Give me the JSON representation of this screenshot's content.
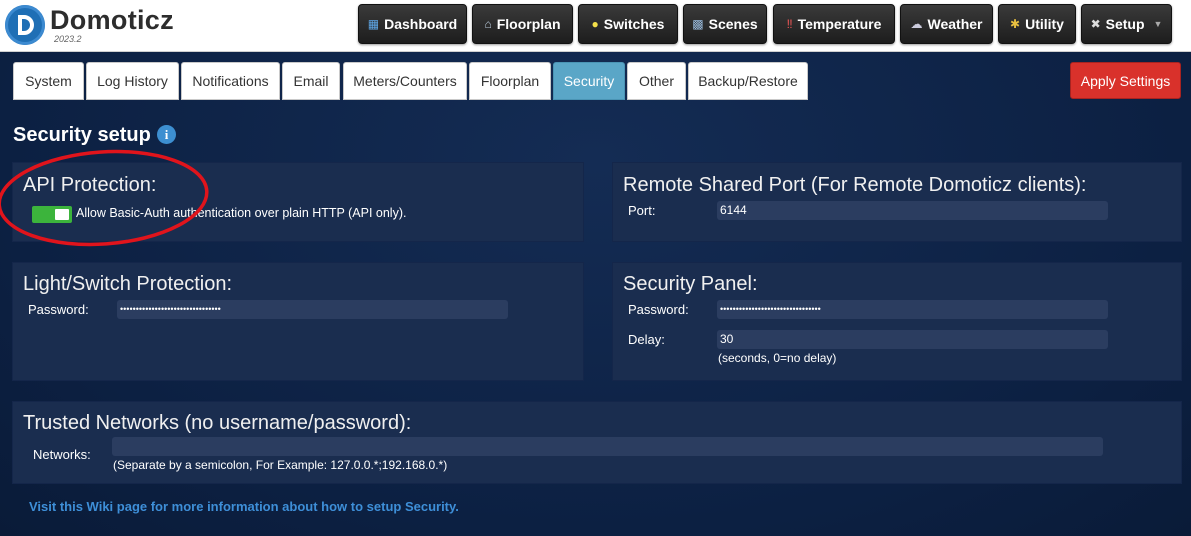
{
  "brand": {
    "name": "Domoticz",
    "version": "2023.2"
  },
  "nav": [
    {
      "label": "Dashboard",
      "icon": "dashboard-icon"
    },
    {
      "label": "Floorplan",
      "icon": "house-icon"
    },
    {
      "label": "Switches",
      "icon": "lightbulb-icon"
    },
    {
      "label": "Scenes",
      "icon": "clapper-icon"
    },
    {
      "label": "Temperature",
      "icon": "thermometer-icon"
    },
    {
      "label": "Weather",
      "icon": "cloud-icon"
    },
    {
      "label": "Utility",
      "icon": "utility-icon"
    },
    {
      "label": "Setup",
      "icon": "tools-icon"
    }
  ],
  "tabs": [
    "System",
    "Log History",
    "Notifications",
    "Email",
    "Meters/Counters",
    "Floorplan",
    "Security",
    "Other",
    "Backup/Restore"
  ],
  "active_tab": "Security",
  "apply_label": "Apply Settings",
  "page_title": "Security setup",
  "api_protection": {
    "title": "API Protection:",
    "toggle_on": true,
    "toggle_label": "Allow Basic-Auth authentication over plain HTTP (API only)."
  },
  "remote_port": {
    "title": "Remote Shared Port (For Remote Domoticz clients):",
    "port_label": "Port:",
    "port_value": "6144"
  },
  "light_switch": {
    "title": "Light/Switch Protection:",
    "password_label": "Password:",
    "password_value": "••••••••••••••••••••••••••••••••"
  },
  "security_panel": {
    "title": "Security Panel:",
    "password_label": "Password:",
    "password_value": "••••••••••••••••••••••••••••••••",
    "delay_label": "Delay:",
    "delay_value": "30",
    "delay_hint": "(seconds, 0=no delay)"
  },
  "trusted": {
    "title": "Trusted Networks (no username/password):",
    "networks_label": "Networks:",
    "networks_value": "",
    "hint": "(Separate by a semicolon, For Example: 127.0.0.*;192.168.0.*)"
  },
  "wiki_link": "Visit this Wiki page for more information about how to setup Security.",
  "colors": {
    "active_tab": "#5aa6c7",
    "apply": "#d9312b",
    "toggle": "#3cb43c",
    "annotation": "#e0141c"
  }
}
